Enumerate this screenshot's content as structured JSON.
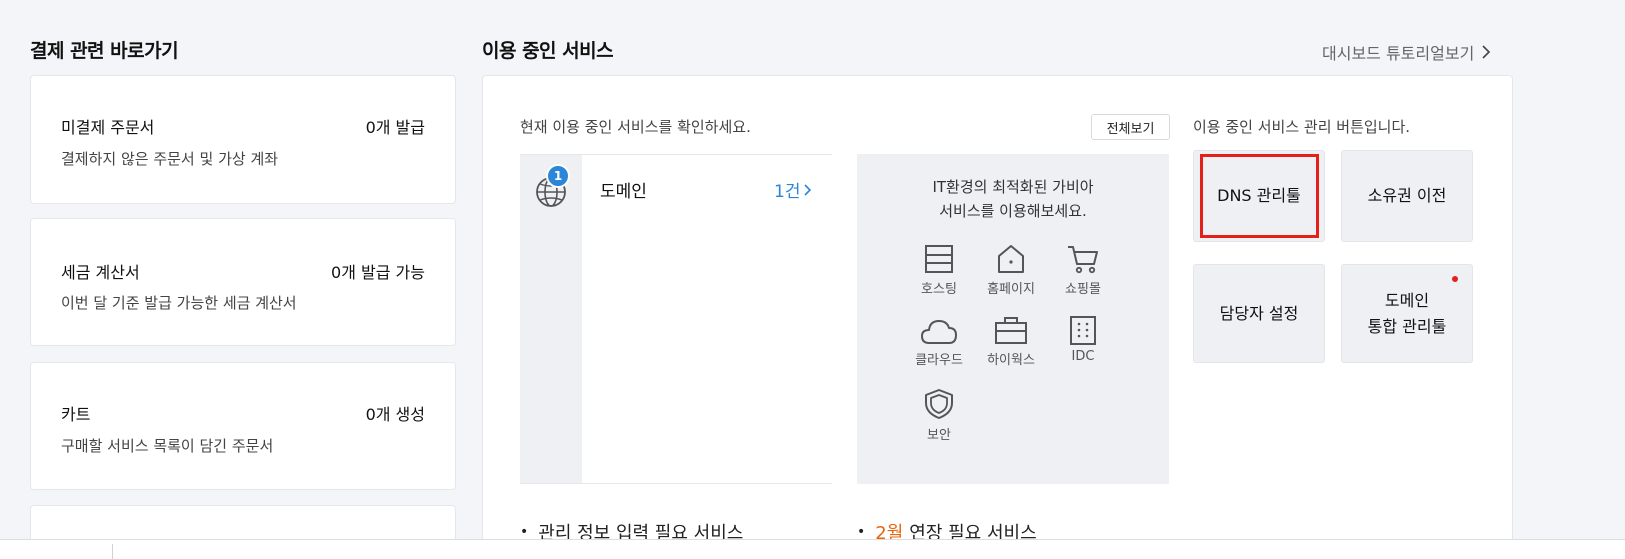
{
  "left": {
    "title": "결제 관련 바로가기",
    "cards": [
      {
        "title": "미결제 주문서",
        "count": "0개 발급",
        "desc": "결제하지 않은 주문서 및 가상 계좌"
      },
      {
        "title": "세금 계산서",
        "count": "0개 발급 가능",
        "desc": "이번 달 기준 발급 가능한 세금 계산서"
      },
      {
        "title": "카트",
        "count": "0개 생성",
        "desc": "구매할 서비스 목록이 담긴 주문서"
      }
    ]
  },
  "main": {
    "title": "이용 중인 서비스",
    "tutorial_link": "대시보드 튜토리얼보기",
    "current_desc": "현재 이용 중인 서비스를 확인하세요.",
    "view_all": "전체보기",
    "services": [
      {
        "name": "도메인",
        "badge": "1",
        "count": "1건"
      }
    ],
    "promo": {
      "line1": "IT환경의 최적화된 가비아",
      "line2": "서비스를 이용해보세요.",
      "items": [
        "호스팅",
        "홈페이지",
        "쇼핑몰",
        "클라우드",
        "하이웍스",
        "IDC",
        "보안"
      ],
      "icons": [
        "hosting-icon",
        "homepage-icon",
        "shopping-cart-icon",
        "cloud-icon",
        "hiworks-icon",
        "idc-building-icon",
        "shield-icon"
      ]
    },
    "management": {
      "desc": "이용 중인 서비스 관리 버튼입니다.",
      "buttons": [
        {
          "label": "DNS 관리툴"
        },
        {
          "label": "소유권 이전"
        },
        {
          "label": "담당자 설정"
        },
        {
          "label1": "도메인",
          "label2": "통합 관리툴"
        }
      ]
    },
    "bottom": {
      "required_info": "관리 정보 입력 필요 서비스",
      "month": "2월",
      "renewal": "연장 필요 서비스"
    },
    "colors": {
      "accent": "#2a86d9",
      "highlight": "#e4201b",
      "month": "#e8650f"
    }
  }
}
